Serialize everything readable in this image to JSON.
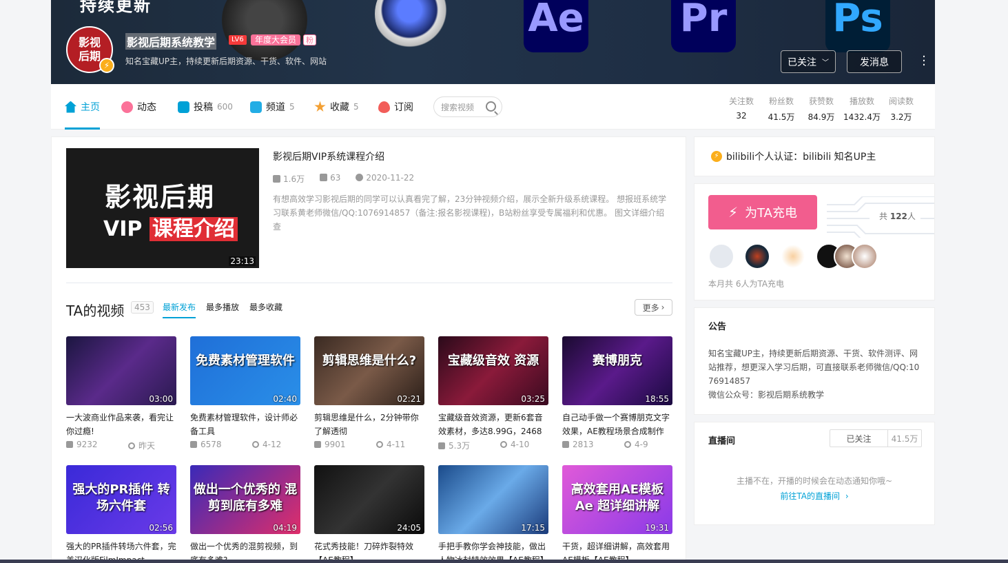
{
  "banner": {
    "big_title": "持续更新",
    "apps": [
      "Ae",
      "Pr",
      "Ps"
    ]
  },
  "profile": {
    "avatar_text": "影视后期",
    "name": "影视后期系统教学",
    "level": "LV6",
    "vip": "年度大会员",
    "fan_badge": "粉",
    "sign": "知名宝藏UP主，持续更新后期资源、干货、软件、网站",
    "follow_label": "已关注",
    "message_label": "发消息"
  },
  "nav": {
    "items": [
      {
        "label": "主页",
        "count": "",
        "color": "#00a1d6"
      },
      {
        "label": "动态",
        "count": "",
        "color": "#fb7299"
      },
      {
        "label": "投稿",
        "count": "600",
        "color": "#00a1d6"
      },
      {
        "label": "频道",
        "count": "5",
        "color": "#23ade5"
      },
      {
        "label": "收藏",
        "count": "5",
        "color": "#f3a034"
      },
      {
        "label": "订阅",
        "count": "",
        "color": "#f25d59"
      }
    ],
    "search_placeholder": "搜索视频",
    "stats": [
      {
        "label": "关注数",
        "value": "32"
      },
      {
        "label": "粉丝数",
        "value": "41.5万"
      },
      {
        "label": "获赞数",
        "value": "84.9万"
      },
      {
        "label": "播放数",
        "value": "1432.4万"
      },
      {
        "label": "阅读数",
        "value": "3.2万"
      }
    ]
  },
  "featured": {
    "cover_line1": "影视后期",
    "cover_line2a": "VIP",
    "cover_line2b": "课程介绍",
    "duration": "23:13",
    "title": "影视后期VIP系统课程介绍",
    "plays": "1.6万",
    "danmaku": "63",
    "date": "2020-11-22",
    "desc": "有想高效学习影视后期的同学可以认真看完了解，23分钟视频介绍，展示全新升级系统课程。 想报班系统学习联系黄老师微信/QQ:1076914857（备注:报名影视课程)，B站粉丝享受专属福利和优惠。 图文详细介绍查"
  },
  "videos_section": {
    "title": "TA的视频",
    "count": "453",
    "tabs": [
      "最新发布",
      "最多播放",
      "最多收藏"
    ],
    "more_label": "更多"
  },
  "videos": [
    {
      "thumb_text": "",
      "duration": "03:00",
      "title": "一大波商业作品来袭，看完让你过瘾!",
      "plays": "9232",
      "date": "昨天",
      "bg": "linear-gradient(135deg,#1b1640,#5a2a8a 50%,#2a1a50)"
    },
    {
      "thumb_text": "免费素材管理软件",
      "duration": "02:40",
      "title": "免费素材管理软件，设计师必备工具",
      "plays": "6578",
      "date": "4-12",
      "bg": "linear-gradient(135deg,#1f6fd8,#2a8fe8)"
    },
    {
      "thumb_text": "剪辑思维是什么?",
      "duration": "02:21",
      "title": "剪辑思维是什么，2分钟带你了解透彻",
      "plays": "9901",
      "date": "4-11",
      "bg": "linear-gradient(135deg,#3a2a22,#7a5a48 50%,#2a1e18)"
    },
    {
      "thumb_text": "宝藏级音效 资源",
      "duration": "03:25",
      "title": "宝藏级音效资源，更新6套音效素材，多达8.99G，2468个",
      "plays": "5.3万",
      "date": "4-10",
      "bg": "linear-gradient(135deg,#2a0a1a,#8a1a3a 50%,#3a0a20)"
    },
    {
      "thumb_text": "赛博朋克",
      "duration": "18:55",
      "title": "自己动手做一个赛博朋克文字效果，AE教程场景合成制作",
      "plays": "2813",
      "date": "4-9",
      "bg": "linear-gradient(135deg,#1a0a30,#5a1a8a 50%,#1a0a40)"
    },
    {
      "thumb_text": "强大的PR插件 转场六件套",
      "duration": "02:56",
      "title": "强大的PR插件转场六件套，完美汉化版FilmImpact",
      "plays": "",
      "date": "",
      "bg": "linear-gradient(135deg,#3a2ad8,#6a3ae8)"
    },
    {
      "thumb_text": "做出一个优秀的 混剪到底有多难",
      "duration": "04:19",
      "title": "做出一个优秀的混剪视频，到底有多难?",
      "plays": "",
      "date": "",
      "bg": "linear-gradient(135deg,#3a2ab8,#e02e6a)"
    },
    {
      "thumb_text": "",
      "duration": "24:05",
      "title": "花式秀技能！刀碎炸裂特效【AE教程】",
      "plays": "",
      "date": "",
      "bg": "linear-gradient(135deg,#111,#333 50%,#0a0a0a)"
    },
    {
      "thumb_text": "",
      "duration": "17:15",
      "title": "手把手教你学会神技能，做出人物冰封特效效果【AE教程】",
      "plays": "",
      "date": "",
      "bg": "linear-gradient(135deg,#1a4a8a,#6aaae8 50%,#1a3a7a)"
    },
    {
      "thumb_text": "高效套用AE模板 Ae 超详细讲解",
      "duration": "19:31",
      "title": "干货，超详细讲解，高效套用AE模板【AE教程】",
      "plays": "",
      "date": "",
      "bg": "linear-gradient(135deg,#e05ad8,#8a3ae8)"
    }
  ],
  "sidebar": {
    "cert": "bilibili个人认证：bilibili 知名UP主",
    "charge_label": "为TA充电",
    "charge_total_prefix": "共",
    "charge_total_num": "122",
    "charge_total_suffix": "人",
    "charge_note": "本月共 6人为TA充电",
    "notice_title": "公告",
    "notice_body": "知名宝藏UP主，持续更新后期资源、干货、软件测评、网站推荐，想更深入学习后期，可直接联系老师微信/QQ:1076914857",
    "notice_body2": "微信公众号：影视后期系统教学",
    "live_title": "直播间",
    "live_follow": "已关注",
    "live_fans": "41.5万",
    "live_msg": "主播不在，开播的时候会在动态通知你哦~",
    "live_link": "前往TA的直播间"
  }
}
